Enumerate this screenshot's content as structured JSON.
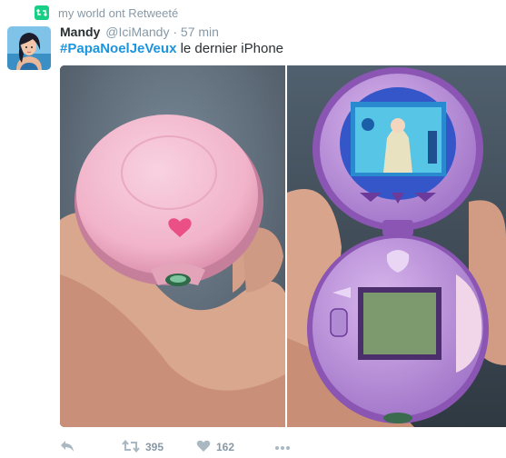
{
  "retweet_context": {
    "icon": "retweet-icon",
    "text": "my world ont Retweeté"
  },
  "tweet": {
    "author": {
      "name": "Mandy",
      "handle": "@IciMandy",
      "avatar_icon": "avatar-illustration"
    },
    "separator": "·",
    "time": "57 min",
    "hashtag": "#PapaNoelJeVeux",
    "text": " le dernier iPhone"
  },
  "media": {
    "photos": [
      {
        "name": "pink-toy-closed-photo"
      },
      {
        "name": "purple-toy-open-photo"
      }
    ]
  },
  "actions": {
    "reply": {
      "icon": "reply-icon"
    },
    "retweet": {
      "icon": "retweet-icon",
      "count": "395"
    },
    "like": {
      "icon": "heart-icon",
      "count": "162"
    },
    "more": {
      "icon": "more-icon"
    }
  },
  "colors": {
    "hashtag": "#1b95e0",
    "retweet_green": "#19cf86",
    "muted": "#8899a6"
  }
}
